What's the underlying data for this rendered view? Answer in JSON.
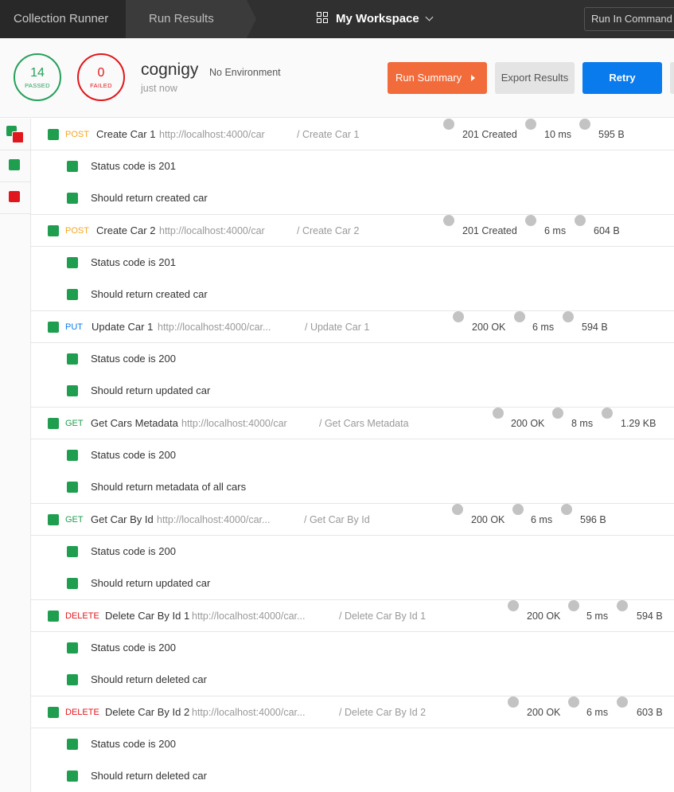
{
  "nav": {
    "tab_runner": "Collection Runner",
    "tab_results": "Run Results",
    "workspace": "My Workspace",
    "command_line": "Run In Command Line"
  },
  "summary": {
    "passed_count": "14",
    "passed_label": "PASSED",
    "failed_count": "0",
    "failed_label": "FAILED",
    "collection": "cognigy",
    "environment": "No Environment",
    "time": "just now",
    "btn_summary": "Run Summary",
    "btn_export": "Export Results",
    "btn_retry": "Retry"
  },
  "requests": [
    {
      "method": "POST",
      "name": "Create Car 1",
      "url": "http://localhost:4000/car",
      "path": "/ Create Car 1",
      "status": "201 Created",
      "time": "10 ms",
      "size": "595 B",
      "tests": [
        "Status code is 201",
        "Should return created car"
      ]
    },
    {
      "method": "POST",
      "name": "Create Car 2",
      "url": "http://localhost:4000/car",
      "path": "/ Create Car 2",
      "status": "201 Created",
      "time": "6 ms",
      "size": "604 B",
      "tests": [
        "Status code is 201",
        "Should return created car"
      ]
    },
    {
      "method": "PUT",
      "name": "Update Car 1",
      "url": "http://localhost:4000/car...",
      "path": "/ Update Car 1",
      "status": "200 OK",
      "time": "6 ms",
      "size": "594 B",
      "tests": [
        "Status code is 200",
        "Should return updated car"
      ]
    },
    {
      "method": "GET",
      "name": "Get Cars Metadata",
      "url": "http://localhost:4000/car",
      "path": "/ Get Cars Metadata",
      "status": "200 OK",
      "time": "8 ms",
      "size": "1.29 KB",
      "tests": [
        "Status code is 200",
        "Should return metadata of all cars"
      ]
    },
    {
      "method": "GET",
      "name": "Get Car By Id",
      "url": "http://localhost:4000/car...",
      "path": "/ Get Car By Id",
      "status": "200 OK",
      "time": "6 ms",
      "size": "596 B",
      "tests": [
        "Status code is 200",
        "Should return updated car"
      ]
    },
    {
      "method": "DELETE",
      "name": "Delete Car By Id 1",
      "url": "http://localhost:4000/car...",
      "path": "/ Delete Car By Id 1",
      "status": "200 OK",
      "time": "5 ms",
      "size": "594 B",
      "tests": [
        "Status code is 200",
        "Should return deleted car"
      ]
    },
    {
      "method": "DELETE",
      "name": "Delete Car By Id 2",
      "url": "http://localhost:4000/car...",
      "path": "/ Delete Car By Id 2",
      "status": "200 OK",
      "time": "6 ms",
      "size": "603 B",
      "tests": [
        "Status code is 200",
        "Should return deleted car"
      ]
    }
  ],
  "colors": {
    "pass": "#1f9e4f",
    "fail": "#e0171c",
    "accent_orange": "#f26b3a",
    "accent_blue": "#097bed",
    "post": "#f5a623",
    "put": "#097bed",
    "get": "#1f9e4f",
    "delete": "#e0171c"
  }
}
